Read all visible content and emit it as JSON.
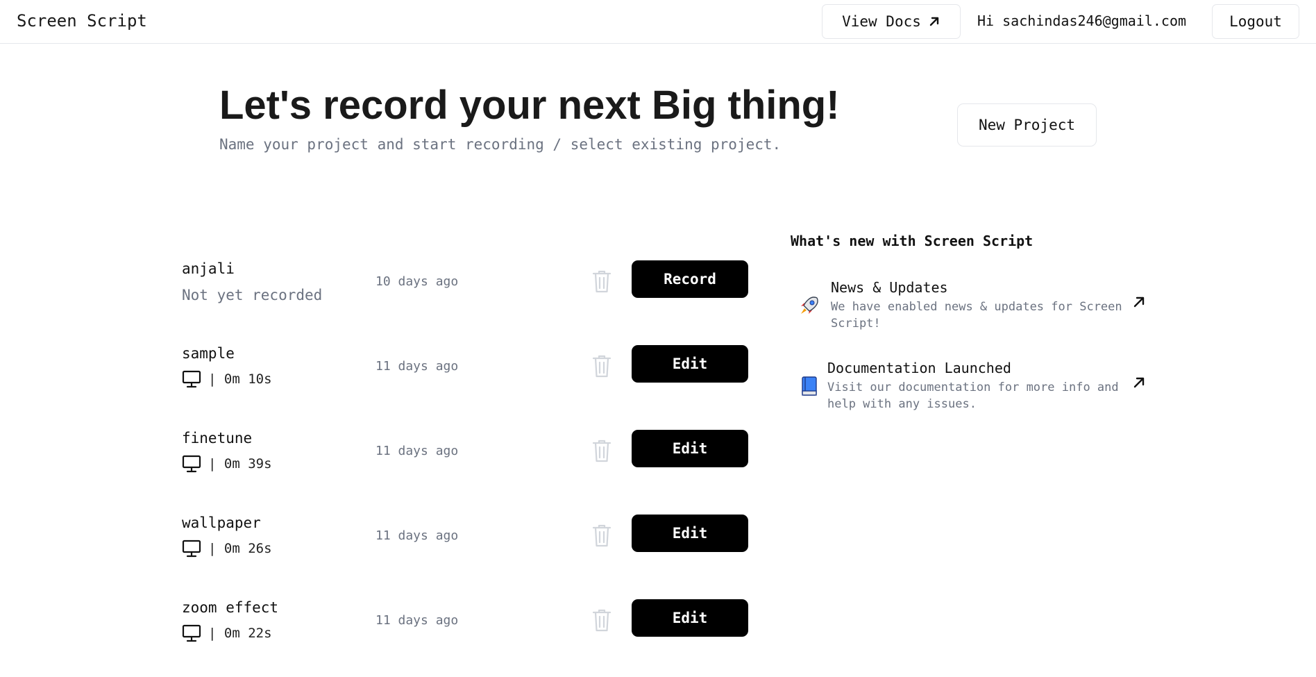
{
  "header": {
    "brand": "Screen Script",
    "view_docs_label": "View Docs",
    "greeting": "Hi sachindas246@gmail.com",
    "logout_label": "Logout"
  },
  "hero": {
    "title": "Let's record your next Big thing!",
    "subtitle": "Name your project and start recording / select existing project.",
    "new_project_label": "New Project"
  },
  "projects": [
    {
      "name": "anjali",
      "status": "Not yet recorded",
      "duration": "",
      "date": "10 days ago",
      "action": "Record"
    },
    {
      "name": "sample",
      "status": "",
      "duration": "| 0m 10s",
      "date": "11 days ago",
      "action": "Edit"
    },
    {
      "name": "finetune",
      "status": "",
      "duration": "| 0m 39s",
      "date": "11 days ago",
      "action": "Edit"
    },
    {
      "name": "wallpaper",
      "status": "",
      "duration": "| 0m 26s",
      "date": "11 days ago",
      "action": "Edit"
    },
    {
      "name": "zoom effect",
      "status": "",
      "duration": "| 0m 22s",
      "date": "11 days ago",
      "action": "Edit"
    }
  ],
  "news": {
    "title": "What's new with Screen Script",
    "items": [
      {
        "icon": "rocket-icon",
        "heading": "News & Updates",
        "body": "We have enabled news & updates for Screen Script!"
      },
      {
        "icon": "book-icon",
        "heading": "Documentation Launched",
        "body": "Visit our documentation for more info and help with any issues."
      }
    ]
  },
  "colors": {
    "primary_button": "#000000",
    "muted_text": "#6b7280",
    "border": "#e5e7eb"
  }
}
